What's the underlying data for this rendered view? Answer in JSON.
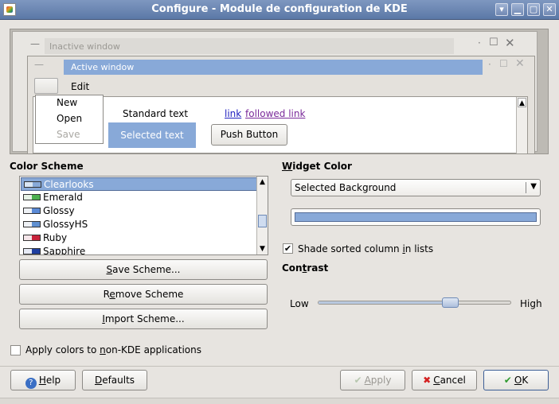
{
  "window": {
    "title": "Configure - Module de configuration de KDE",
    "controls": [
      "▁",
      "▢",
      "✕"
    ]
  },
  "preview": {
    "inactive_title": "Inactive window",
    "active_title": "Active window",
    "menu_edit": "Edit",
    "popup_items": [
      {
        "label": "New",
        "disabled": false
      },
      {
        "label": "Open",
        "disabled": false
      },
      {
        "label": "Save",
        "disabled": true
      }
    ],
    "standard_text": "Standard text",
    "selected_text": "Selected text",
    "link": "link",
    "followed_link": "followed link",
    "push_button": "Push Button"
  },
  "color_scheme": {
    "heading": "Color Scheme",
    "items": [
      {
        "label": "Clearlooks",
        "selected": true,
        "swatch": [
          "#d9e6f5",
          "#88a9d8"
        ]
      },
      {
        "label": "Emerald",
        "selected": false,
        "swatch": [
          "#e6f2e6",
          "#4caf50"
        ]
      },
      {
        "label": "Glossy",
        "selected": false,
        "swatch": [
          "#eef1f5",
          "#5b8ad6"
        ]
      },
      {
        "label": "GlossyHS",
        "selected": false,
        "swatch": [
          "#eef1f5",
          "#6090d0"
        ]
      },
      {
        "label": "Ruby",
        "selected": false,
        "swatch": [
          "#f5e6ea",
          "#c8243c"
        ]
      },
      {
        "label": "Sapphire",
        "selected": false,
        "swatch": [
          "#e6eaf5",
          "#1f3fa0"
        ]
      }
    ],
    "buttons": {
      "save": {
        "pre": "",
        "accel": "S",
        "post": "ave Scheme..."
      },
      "remove": {
        "pre": "R",
        "accel": "e",
        "post": "move Scheme"
      },
      "import": {
        "pre": "",
        "accel": "I",
        "post": "mport Scheme..."
      }
    }
  },
  "widget_color": {
    "heading": {
      "accel": "W",
      "rest": "idget Color"
    },
    "selected": "Selected Background",
    "color_swatch": "#88a9d8",
    "shade_sorted": {
      "pre": "Shade sorted column ",
      "accel": "i",
      "post": "n lists",
      "checked": true
    }
  },
  "contrast": {
    "heading": {
      "pre": "Con",
      "accel": "t",
      "post": "rast"
    },
    "low": "Low",
    "high": "High",
    "value": 0.68
  },
  "apply_non_kde": {
    "pre": "Apply colors to ",
    "accel": "n",
    "post": "on-KDE applications",
    "checked": false
  },
  "dialog_buttons": {
    "help": {
      "accel": "H",
      "rest": "elp"
    },
    "defaults": {
      "accel": "D",
      "rest": "efaults"
    },
    "apply": {
      "accel": "A",
      "rest": "pply",
      "disabled": true
    },
    "cancel": {
      "accel": "C",
      "rest": "ancel"
    },
    "ok": {
      "accel": "O",
      "rest": "K"
    }
  },
  "colors": {
    "selection": "#88a9d8",
    "titlebar": "#6b86b5"
  }
}
